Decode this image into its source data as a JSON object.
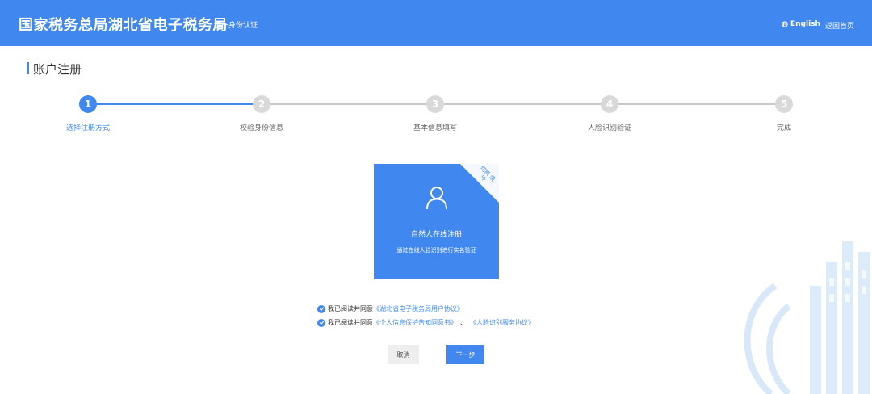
{
  "header": {
    "title": "国家税务总局湖北省电子税务局",
    "subtitle": "统一身份认证",
    "lang_label": "English",
    "home_label": "返回首页",
    "bg_color": "#4088f0"
  },
  "section": {
    "title": "账户注册"
  },
  "steps": [
    {
      "num": "1",
      "label": "选择注册方式",
      "state": "active"
    },
    {
      "num": "2",
      "label": "校验身份信息",
      "state": "pending"
    },
    {
      "num": "3",
      "label": "基本信息填写",
      "state": "pending"
    },
    {
      "num": "4",
      "label": "人脸识别验证",
      "state": "pending"
    },
    {
      "num": "5",
      "label": "完成",
      "state": "pending"
    }
  ],
  "card": {
    "corner_text": "切换 境外",
    "icon": "user-icon",
    "title": "自然人在线注册",
    "desc": "通过在线人脸识别进行实名验证"
  },
  "agreements": [
    {
      "prefix": "我已阅读并同意",
      "links": [
        "《湖北省电子税务局用户协议》"
      ]
    },
    {
      "prefix": "我已阅读并同意",
      "links": [
        "《个人信息保护告知同意书》",
        "《人脸识别服务协议》"
      ],
      "joiner": "、"
    }
  ],
  "buttons": {
    "cancel": "取消",
    "next": "下一步"
  },
  "colors": {
    "accent": "#4088f0",
    "inactive": "#d9d9d9"
  }
}
